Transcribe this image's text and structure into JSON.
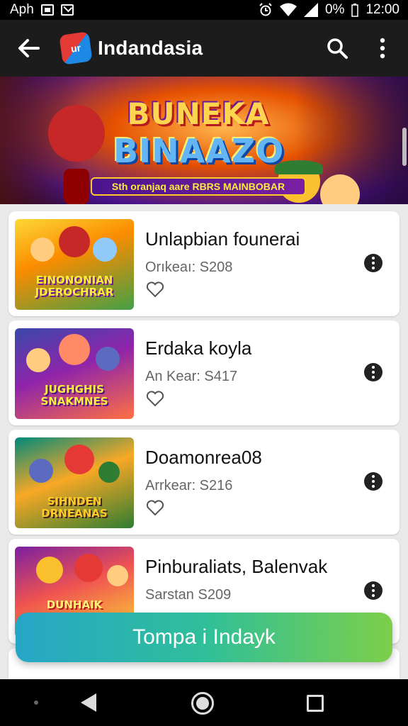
{
  "status_bar": {
    "app_label": "Aph",
    "battery": "0%",
    "time": "12:00"
  },
  "app_bar": {
    "title": "Indandasia",
    "logo_text": "ur",
    "icons": {
      "back": "back-arrow-icon",
      "search": "search-icon",
      "more": "more-vert-icon"
    }
  },
  "banner": {
    "title_line1": "BUNEKA",
    "title_line2": "BINAAZO",
    "subtitle": "Sth oranjaq aare  RBRS MAINBOBAR"
  },
  "items": [
    {
      "title": "Unlapbian founerai",
      "subtitle": "Orıkeaı: S208",
      "thumb_text": "EINONONIAN\nJDEROCHRAR"
    },
    {
      "title": "Erdaka koyla",
      "subtitle": "An Kear: S417",
      "thumb_text": "JUGHGHIS\nSNAKMNES"
    },
    {
      "title": "Doamonrea08",
      "subtitle": "Arrkear: S216",
      "thumb_text": "SIHNDEN\nDRNEANAS"
    },
    {
      "title": "Pinburaliats, Balenvak",
      "subtitle": "Sarstan S209",
      "thumb_text": "DUNHAIK\nSEEBHAN"
    }
  ],
  "cta": {
    "label": "Tompa i Indayk"
  },
  "colors": {
    "app_bar_bg": "#1c1c1c",
    "list_bg": "#e9e9e9",
    "cta_gradient_start": "#26a6c7",
    "cta_gradient_end": "#7ccf4a"
  }
}
